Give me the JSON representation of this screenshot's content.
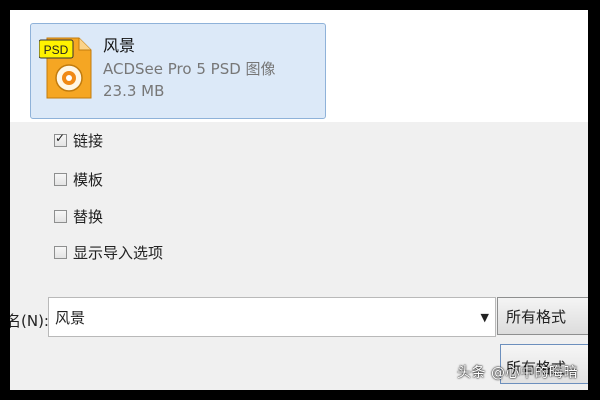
{
  "file": {
    "name": "风景",
    "type": "ACDSee Pro 5 PSD 图像",
    "size": "23.3 MB",
    "icon_label": "PSD"
  },
  "options": [
    {
      "label": "链接",
      "checked": true
    },
    {
      "label": "模板",
      "checked": false
    },
    {
      "label": "替换",
      "checked": false
    },
    {
      "label": "显示导入选项",
      "checked": false
    }
  ],
  "filename": {
    "label": "名(N):",
    "value": "风景"
  },
  "format_dropdown": {
    "value": "所有格式"
  },
  "format_button": {
    "value": "所有格式"
  },
  "watermark": "头条 @心中的晦暗"
}
